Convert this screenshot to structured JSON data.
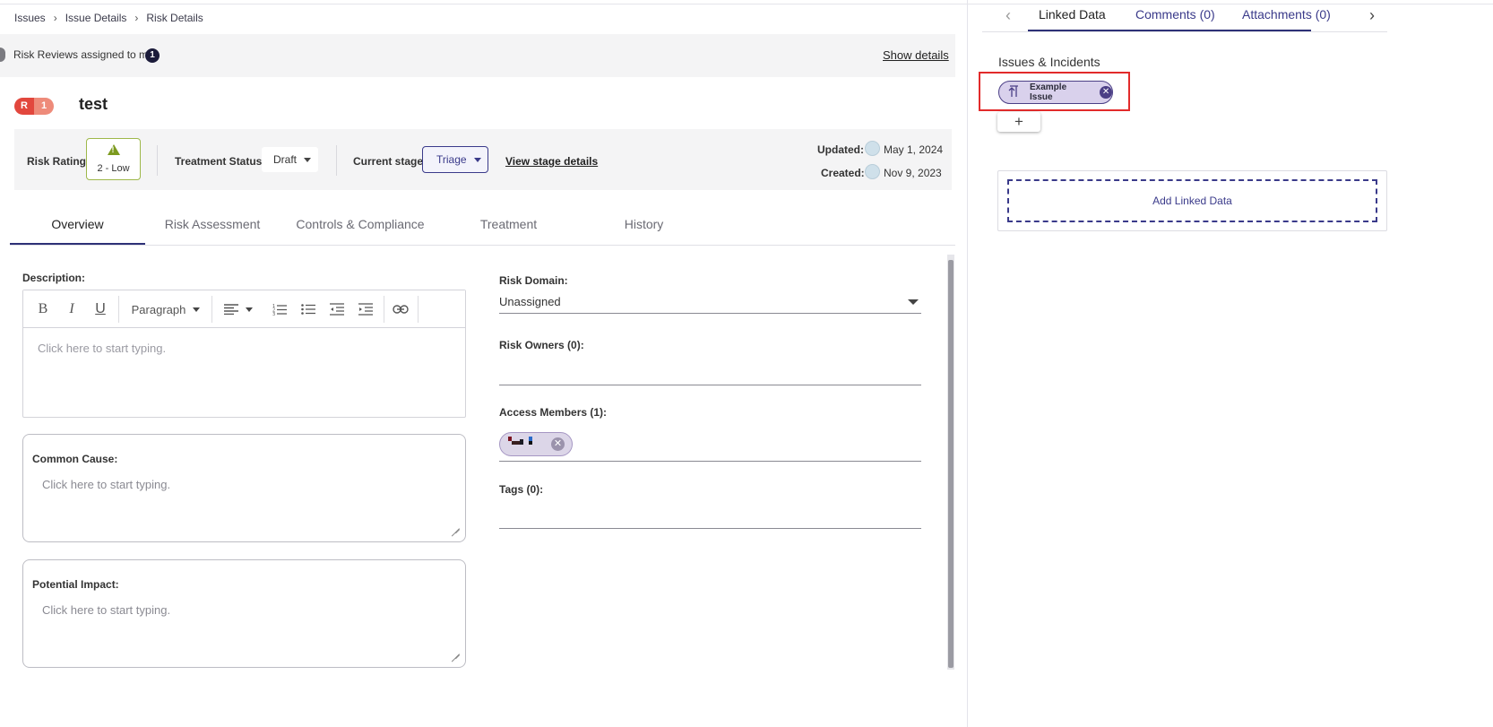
{
  "breadcrumb": [
    "Issues",
    "Issue Details",
    "Risk Details"
  ],
  "review_bar": {
    "text": "Risk Reviews assigned to me",
    "count": "1",
    "show_details": "Show details"
  },
  "risk": {
    "badge_letter": "R",
    "badge_number": "1",
    "title": "test"
  },
  "status": {
    "rating_label": "Risk Rating:",
    "rating_value": "2 - Low",
    "treatment_label": "Treatment Status:",
    "treatment_value": "Draft",
    "stage_label": "Current stage:",
    "stage_value": "Triage",
    "view_stage": "View stage details",
    "updated_label": "Updated:",
    "updated_value": "May 1, 2024",
    "created_label": "Created:",
    "created_value": "Nov 9, 2023"
  },
  "tabs": [
    "Overview",
    "Risk Assessment",
    "Controls & Compliance",
    "Treatment",
    "History"
  ],
  "active_tab": "Overview",
  "description": {
    "label": "Description:",
    "placeholder": "Click here to start typing.",
    "toolbar": {
      "bold": "B",
      "italic": "I",
      "underline": "U",
      "paragraph": "Paragraph"
    }
  },
  "common_cause": {
    "label": "Common Cause:",
    "placeholder": "Click here to start typing."
  },
  "potential_impact": {
    "label": "Potential Impact:",
    "placeholder": "Click here to start typing."
  },
  "risk_domain": {
    "label": "Risk Domain:",
    "value": "Unassigned"
  },
  "risk_owners": {
    "label": "Risk Owners (0):"
  },
  "access_members": {
    "label": "Access Members (1):"
  },
  "tags": {
    "label": "Tags (0):"
  },
  "right_panel": {
    "tabs": [
      "Linked Data",
      "Comments (0)",
      "Attachments (0)"
    ],
    "active_tab": "Linked Data",
    "issues_heading": "Issues & Incidents",
    "linked_issue": "Example Issue",
    "add_symbol": "+",
    "add_linked_data": "Add Linked Data"
  },
  "colors": {
    "accent": "#2e3177",
    "risk_badge": "#e2473d",
    "low_rating": "#7c9a1e",
    "highlight": "#e22b2b"
  }
}
